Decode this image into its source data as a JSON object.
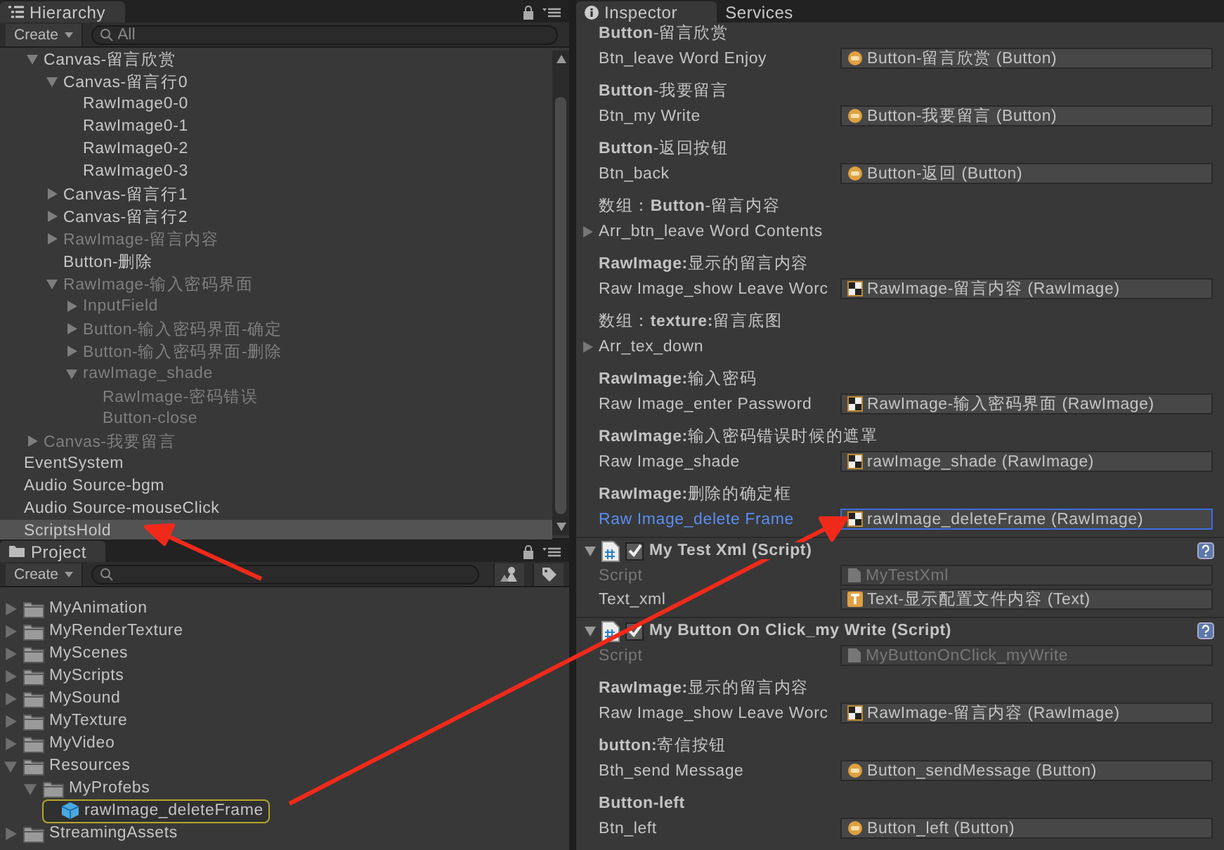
{
  "hierarchy": {
    "tab": {
      "label": "Hierarchy",
      "selected": true
    },
    "create_button": "Create",
    "search": {
      "placeholder": "All"
    },
    "tree": [
      {
        "children": [
          {
            "label": "Canvas-留言欣赏",
            "expanded": true,
            "inactive": false,
            "selected": false,
            "children": [
              {
                "label": "Canvas-留言行0",
                "expanded": true,
                "inactive": false,
                "selected": false,
                "children": [
                  {
                    "label": "RawImage0-0",
                    "inactive": false,
                    "selected": false
                  },
                  {
                    "label": "RawImage0-1",
                    "inactive": false,
                    "selected": false
                  },
                  {
                    "label": "RawImage0-2",
                    "inactive": false,
                    "selected": false
                  },
                  {
                    "label": "RawImage0-3",
                    "inactive": false,
                    "selected": false
                  }
                ]
              },
              {
                "label": "Canvas-留言行1",
                "expanded": false,
                "inactive": false,
                "selected": false
              },
              {
                "label": "Canvas-留言行2",
                "expanded": false,
                "inactive": false,
                "selected": false
              },
              {
                "label": "RawImage-留言内容",
                "expanded": false,
                "inactive": true,
                "selected": false
              },
              {
                "label": "Button-删除",
                "inactive": false,
                "selected": false
              },
              {
                "label": "RawImage-输入密码界面",
                "expanded": true,
                "inactive": true,
                "selected": false,
                "children": [
                  {
                    "label": "InputField",
                    "expanded": false,
                    "inactive": true,
                    "selected": false
                  },
                  {
                    "label": "Button-输入密码界面-确定",
                    "expanded": false,
                    "inactive": true,
                    "selected": false
                  },
                  {
                    "label": "Button-输入密码界面-删除",
                    "expanded": false,
                    "inactive": true,
                    "selected": false
                  },
                  {
                    "label": "rawImage_shade",
                    "expanded": true,
                    "inactive": true,
                    "selected": false,
                    "children": [
                      {
                        "label": "RawImage-密码错误",
                        "inactive": true,
                        "selected": false
                      },
                      {
                        "label": "Button-close",
                        "inactive": true,
                        "selected": false
                      }
                    ]
                  }
                ]
              }
            ]
          },
          {
            "label": "Canvas-我要留言",
            "expanded": false,
            "inactive": true,
            "selected": false
          }
        ]
      },
      {
        "label": "EventSystem",
        "inactive": false,
        "selected": false
      },
      {
        "label": "Audio Source-bgm",
        "inactive": false,
        "selected": false
      },
      {
        "label": "Audio Source-mouseClick",
        "inactive": false,
        "selected": false
      },
      {
        "label": "ScriptsHold",
        "inactive": false,
        "selected": true
      }
    ]
  },
  "project": {
    "tab": {
      "label": "Project",
      "selected": true
    },
    "create_button": "Create",
    "tree": [
      {
        "kind": "folder",
        "label": "MyAnimation",
        "expanded": false,
        "selected": false
      },
      {
        "kind": "folder",
        "label": "MyRenderTexture",
        "expanded": false,
        "selected": false
      },
      {
        "kind": "folder",
        "label": "MyScenes",
        "expanded": false,
        "selected": false
      },
      {
        "kind": "folder",
        "label": "MyScripts",
        "expanded": false,
        "selected": false
      },
      {
        "kind": "folder",
        "label": "MySound",
        "expanded": false,
        "selected": false
      },
      {
        "kind": "folder",
        "label": "MyTexture",
        "expanded": false,
        "selected": false
      },
      {
        "kind": "folder",
        "label": "MyVideo",
        "expanded": false,
        "selected": false
      },
      {
        "kind": "folder",
        "label": "Resources",
        "expanded": true,
        "selected": false,
        "children": [
          {
            "kind": "folder",
            "label": "MyProfebs",
            "expanded": true,
            "selected": false,
            "children": [
              {
                "kind": "prefab",
                "label": "rawImage_deleteFrame",
                "selected": true
              }
            ]
          }
        ]
      },
      {
        "kind": "folder",
        "label": "StreamingAssets",
        "expanded": false,
        "selected": false
      }
    ]
  },
  "inspector": {
    "tabs": [
      {
        "label": "Inspector",
        "selected": true
      },
      {
        "label": "Services",
        "selected": false
      }
    ],
    "components": [
      {
        "properties": [
          {
            "kind": "header",
            "text": "**Button**-留言欣赏"
          },
          {
            "kind": "button",
            "label": "Btn_leave Word Enjoy",
            "value": "Button-留言欣赏 (Button)",
            "selected": false
          },
          {
            "kind": "header",
            "text": "**Button**-我要留言"
          },
          {
            "kind": "button",
            "label": "Btn_my Write",
            "value": "Button-我要留言 (Button)",
            "selected": false
          },
          {
            "kind": "header",
            "text": "**Button**-返回按钮"
          },
          {
            "kind": "button",
            "label": "Btn_back",
            "value": "Button-返回 (Button)",
            "selected": false
          },
          {
            "kind": "header",
            "text": "数组：**Button**-留言内容"
          },
          {
            "kind": "array",
            "label": "Arr_btn_leave Word Contents",
            "expanded": false
          },
          {
            "kind": "header",
            "text": "**RawImage:**显示的留言内容"
          },
          {
            "kind": "rawimage",
            "label": "Raw Image_show Leave Worc",
            "value": "RawImage-留言内容 (RawImage)",
            "selected": false
          },
          {
            "kind": "header",
            "text": "数组：**texture:**留言底图"
          },
          {
            "kind": "array",
            "label": "Arr_tex_down",
            "expanded": false
          },
          {
            "kind": "header",
            "text": "**RawImage:**输入密码"
          },
          {
            "kind": "rawimage",
            "label": "Raw Image_enter Password",
            "value": "RawImage-输入密码界面 (RawImage)",
            "selected": false
          },
          {
            "kind": "header",
            "text": "**RawImage:**输入密码错误时候的遮罩"
          },
          {
            "kind": "rawimage",
            "label": "Raw Image_shade",
            "value": "rawImage_shade (RawImage)",
            "selected": false
          },
          {
            "kind": "header",
            "text": "**RawImage:**删除的确定框"
          },
          {
            "kind": "rawimage",
            "label": "Raw Image_delete Frame",
            "value": "rawImage_deleteFrame (RawImage)",
            "selected": true
          }
        ]
      },
      {
        "title": "My Test Xml (Script)",
        "enabled": true,
        "expanded": true,
        "properties": [
          {
            "kind": "script",
            "label": "Script",
            "value": "MyTestXml"
          },
          {
            "kind": "text",
            "label": "Text_xml",
            "value": "Text-显示配置文件内容 (Text)",
            "selected": false
          }
        ]
      },
      {
        "title": "My Button On Click_my Write (Script)",
        "enabled": true,
        "expanded": true,
        "properties": [
          {
            "kind": "script",
            "label": "Script",
            "value": "MyButtonOnClick_myWrite"
          },
          {
            "kind": "header",
            "text": "**RawImage:**显示的留言内容"
          },
          {
            "kind": "rawimage",
            "label": "Raw Image_show Leave Worc",
            "value": "RawImage-留言内容 (RawImage)",
            "selected": false
          },
          {
            "kind": "header",
            "text": "**button:**寄信按钮"
          },
          {
            "kind": "button",
            "label": "Bth_send Message",
            "value": "Button_sendMessage (Button)",
            "selected": false
          },
          {
            "kind": "header",
            "text": "**Button-left**"
          },
          {
            "kind": "button",
            "label": "Btn_left",
            "value": "Button_left (Button)",
            "selected": false
          }
        ]
      }
    ]
  }
}
